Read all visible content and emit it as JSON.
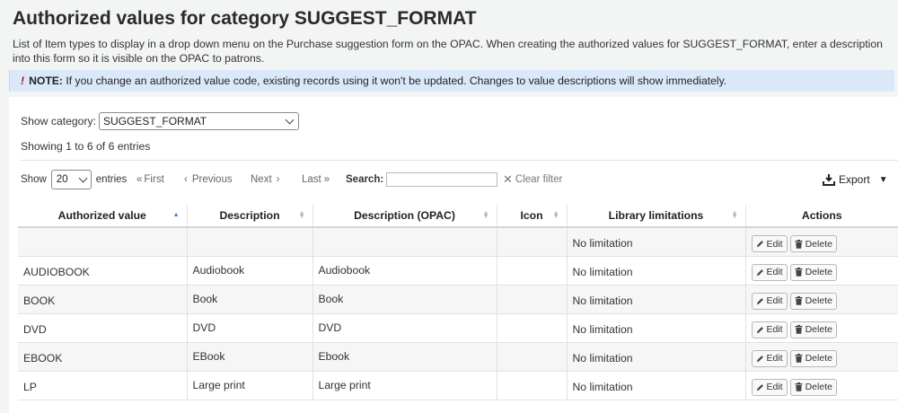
{
  "page": {
    "title": "Authorized values for category SUGGEST_FORMAT",
    "description": "List of Item types to display in a drop down menu on the Purchase suggestion form on the OPAC. When creating the authorized values for SUGGEST_FORMAT, enter a description into this form so it is visible on the OPAC to patrons."
  },
  "note": {
    "bang": "!",
    "label": "NOTE:",
    "text": " If you change an authorized value code, existing records using it won't be updated. Changes to value descriptions will show immediately."
  },
  "filter": {
    "show_category_label": "Show category:",
    "selected_category": "SUGGEST_FORMAT"
  },
  "showing_text": "Showing 1 to 6 of 6 entries",
  "toolbar": {
    "show_label": "Show",
    "page_length": "20",
    "entries_label": "entries",
    "first": "First",
    "previous": "Previous",
    "next": "Next",
    "last": "Last",
    "search_label": "Search:",
    "search_value": "",
    "clear_filter": "Clear filter",
    "export": "Export"
  },
  "table": {
    "columns": [
      "Authorized value",
      "Description",
      "Description (OPAC)",
      "Icon",
      "Library limitations",
      "Actions"
    ],
    "edit_label": "Edit",
    "delete_label": "Delete",
    "rows": [
      {
        "value": "",
        "description": "",
        "opac": "",
        "icon": "",
        "limitation": "No limitation"
      },
      {
        "value": "AUDIOBOOK",
        "description": "Audiobook",
        "opac": "Audiobook",
        "icon": "",
        "limitation": "No limitation"
      },
      {
        "value": "BOOK",
        "description": "Book",
        "opac": "Book",
        "icon": "",
        "limitation": "No limitation"
      },
      {
        "value": "DVD",
        "description": "DVD",
        "opac": "DVD",
        "icon": "",
        "limitation": "No limitation"
      },
      {
        "value": "EBOOK",
        "description": "EBook",
        "opac": "Ebook",
        "icon": "",
        "limitation": "No limitation"
      },
      {
        "value": "LP",
        "description": "Large print",
        "opac": "Large print",
        "icon": "",
        "limitation": "No limitation"
      }
    ]
  }
}
